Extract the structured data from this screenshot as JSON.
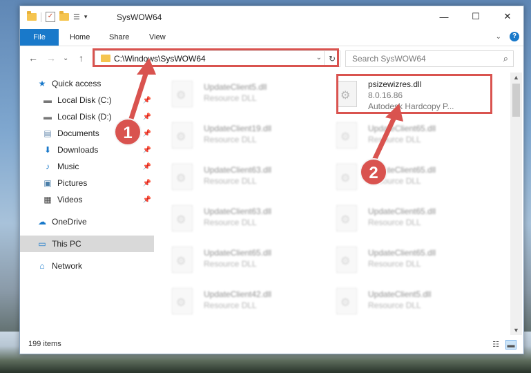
{
  "window": {
    "title": "SysWOW64",
    "controls": {
      "minimize": "—",
      "maximize": "☐",
      "close": "✕"
    }
  },
  "quick_access_toolbar": {
    "dropdown": "▾"
  },
  "ribbon": {
    "file_tab": "File",
    "tabs": [
      "Home",
      "Share",
      "View"
    ],
    "collapse": "⌄",
    "help": "?"
  },
  "nav": {
    "back": "←",
    "forward": "→",
    "recent": "⌄",
    "up": "↑",
    "address": "C:\\Windows\\SysWOW64",
    "address_dropdown": "⌄",
    "refresh": "↻",
    "search_placeholder": "Search SysWOW64",
    "search_icon": "⌕"
  },
  "sidebar": {
    "items": [
      {
        "label": "Quick access",
        "icon": "star-icon",
        "pinned": false
      },
      {
        "label": "Local Disk (C:)",
        "icon": "drive-icon",
        "pinned": true
      },
      {
        "label": "Local Disk (D:)",
        "icon": "drive-icon",
        "pinned": true
      },
      {
        "label": "Documents",
        "icon": "documents-icon",
        "pinned": true
      },
      {
        "label": "Downloads",
        "icon": "download-icon",
        "pinned": true
      },
      {
        "label": "Music",
        "icon": "music-icon",
        "pinned": true
      },
      {
        "label": "Pictures",
        "icon": "pictures-icon",
        "pinned": true
      },
      {
        "label": "Videos",
        "icon": "videos-icon",
        "pinned": true
      },
      {
        "label": "OneDrive",
        "icon": "cloud-icon",
        "pinned": false
      },
      {
        "label": "This PC",
        "icon": "computer-icon",
        "pinned": false,
        "selected": true
      },
      {
        "label": "Network",
        "icon": "network-icon",
        "pinned": false
      }
    ]
  },
  "files": {
    "highlighted": {
      "name": "psizewizres.dll",
      "version": "8.0.16.86",
      "company": "Autodesk Hardcopy P..."
    },
    "left_column": [
      {
        "name": "UpdateClient5.dll",
        "desc": "Resource DLL"
      },
      {
        "name": "UpdateClient19.dll",
        "desc": "Resource DLL"
      },
      {
        "name": "UpdateClient63.dll",
        "desc": "Resource DLL"
      },
      {
        "name": "UpdateClient63.dll",
        "desc": "Resource DLL"
      },
      {
        "name": "UpdateClient65.dll",
        "desc": "Resource DLL"
      },
      {
        "name": "UpdateClient42.dll",
        "desc": "Resource DLL"
      }
    ],
    "right_column": [
      {
        "name": "UpdateClient65.dll",
        "desc": "Resource DLL"
      },
      {
        "name": "UpdateClient65.dll",
        "desc": "Resource DLL"
      },
      {
        "name": "UpdateClient65.dll",
        "desc": "Resource DLL"
      },
      {
        "name": "UpdateClient65.dll",
        "desc": "Resource DLL"
      },
      {
        "name": "UpdateClient5.dll",
        "desc": "Resource DLL"
      }
    ]
  },
  "status": {
    "item_count": "199 items"
  },
  "annotations": {
    "marker_1": "1",
    "marker_2": "2",
    "color": "#d9534f"
  },
  "colors": {
    "accent": "#1979ca",
    "highlight": "#d9534f",
    "selected_nav": "#d9d9d9"
  }
}
